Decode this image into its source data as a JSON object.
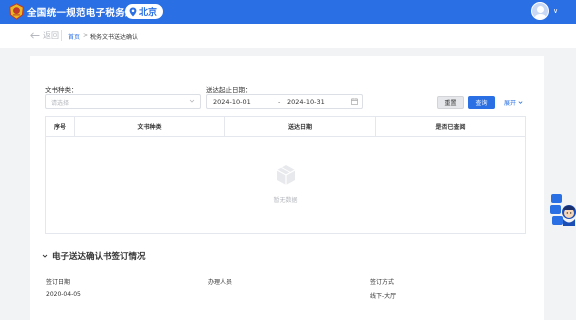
{
  "header": {
    "app_title": "全国统一规范电子税务局",
    "region": "北京",
    "user_menu_chevron": "∨"
  },
  "breadcrumb": {
    "back_label": "返回",
    "home_label": "首页",
    "separator": ">",
    "current_label": "税务文书送达确认"
  },
  "filters": {
    "doc_type_label": "文书种类：",
    "doc_type_placeholder": "请选择",
    "date_label": "送达起止日期：",
    "date_start": "2024-10-01",
    "date_separator": "-",
    "date_end": "2024-10-31",
    "reset_label": "重置",
    "query_label": "查询",
    "expand_label": "展开"
  },
  "table": {
    "columns": [
      "序号",
      "文书种类",
      "送达日期",
      "是否已查阅"
    ],
    "empty_text": "暂无数据"
  },
  "sign_section": {
    "title": "电子送达确认书签订情况",
    "fields": [
      {
        "label": "签订日期",
        "value": "2020-04-05"
      },
      {
        "label": "办理人员",
        "value": ""
      },
      {
        "label": "签订方式",
        "value": "线下-大厅"
      }
    ]
  },
  "colors": {
    "brand_blue": "#2a6fe3",
    "page_bg": "#f2f3f5"
  }
}
